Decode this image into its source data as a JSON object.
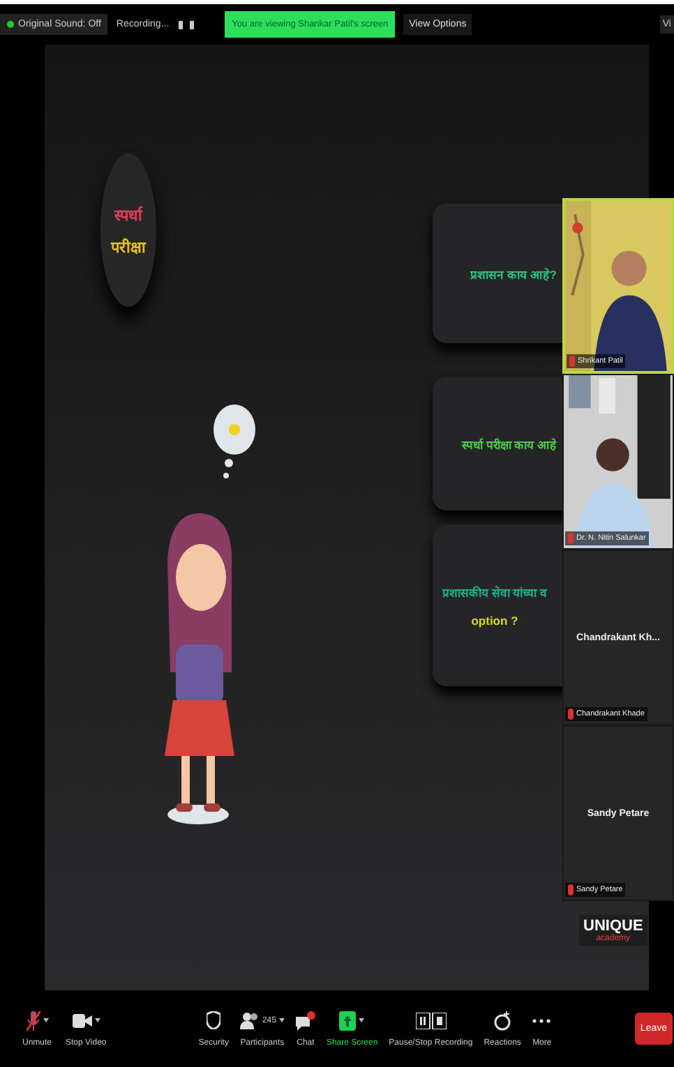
{
  "top_bar": {
    "audio_button": "Original Sound: Off",
    "recording": "Recording...",
    "sharing_banner": "You are viewing Shankar Patil's screen",
    "view_options": "View Options",
    "edge_button": "Vi"
  },
  "slide": {
    "badge_lines": [
      {
        "text": "स्पर्धा",
        "color": "#e0405a"
      },
      {
        "text": "परीक्षा",
        "color": "#e8c020"
      }
    ],
    "cards": [
      {
        "lines": [
          {
            "text": "प्रशासन काय आहे?",
            "color": "#2ec27e"
          }
        ]
      },
      {
        "lines": [
          {
            "text": "स्पर्धा परीक्षा काय आहे",
            "color": "#4cc94a"
          }
        ]
      },
      {
        "lines": [
          {
            "text": "प्रशासकीय सेवा यांच्या व",
            "color": "#1fae8c"
          },
          {
            "text": "option ?",
            "color": "#d8d820"
          }
        ]
      }
    ],
    "logo": {
      "line_1": "UNIQUE",
      "line_2": "academy"
    }
  },
  "videos": [
    {
      "kind": "camera",
      "name": "Shrikant Patil",
      "active": true
    },
    {
      "kind": "camera",
      "name": "Dr. N. Nitin Salunkar",
      "active": false
    },
    {
      "kind": "avatar",
      "display_name": "Chandrakant Kh...",
      "name": "Chandrakant Khade",
      "active": false
    },
    {
      "kind": "avatar",
      "display_name": "Sandy Petare",
      "name": "Sandy Petare",
      "active": false
    }
  ],
  "toolbar": [
    {
      "kind": "mic",
      "label": "Unmute",
      "caret": true
    },
    {
      "kind": "video",
      "label": "Stop Video",
      "caret": true
    },
    {
      "kind": "security",
      "label": "Security",
      "caret": false
    },
    {
      "kind": "participants",
      "label": "Participants",
      "caret": true,
      "count": "245"
    },
    {
      "kind": "chat",
      "label": "Chat",
      "caret": false
    },
    {
      "kind": "share",
      "label": "Share Screen",
      "caret": true
    },
    {
      "kind": "recording",
      "label": "Pause/Stop Recording",
      "caret": false
    },
    {
      "kind": "reactions",
      "label": "Reactions",
      "caret": false
    },
    {
      "kind": "more",
      "label": "More",
      "caret": false
    }
  ],
  "leave_button": "Leave"
}
